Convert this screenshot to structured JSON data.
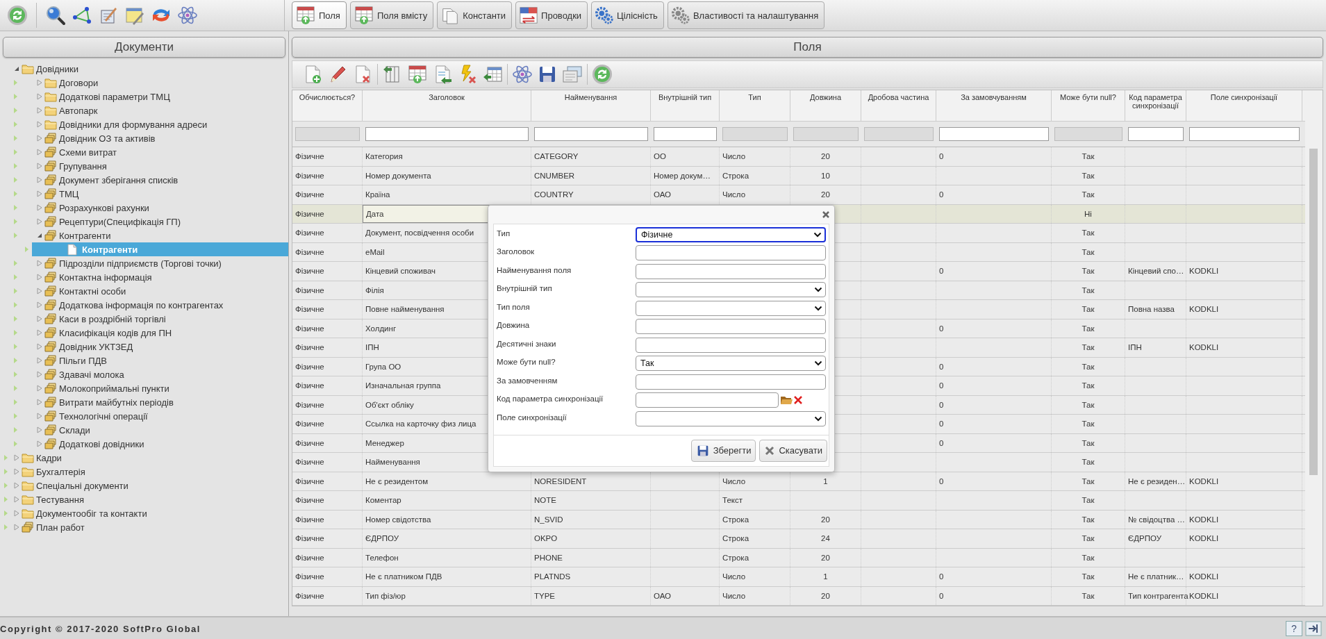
{
  "tabs": [
    {
      "label": "Поля",
      "selected": true
    },
    {
      "label": "Поля вмісту",
      "selected": false
    },
    {
      "label": "Константи",
      "selected": false
    },
    {
      "label": "Проводки",
      "selected": false
    },
    {
      "label": "Цілісність",
      "selected": false
    },
    {
      "label": "Властивості та налаштування",
      "selected": false
    }
  ],
  "sidebar": {
    "title": "Документи",
    "tree": [
      {
        "label": "Довідники",
        "kind": "folder",
        "expanded": true,
        "selected": false,
        "children": [
          {
            "label": "Договори",
            "kind": "folder",
            "expanded": false,
            "selected": false
          },
          {
            "label": "Додаткові параметри ТМЦ",
            "kind": "folder",
            "expanded": false,
            "selected": false
          },
          {
            "label": "Автопарк",
            "kind": "folder",
            "expanded": false,
            "selected": false
          },
          {
            "label": "Довідники для формування адреси",
            "kind": "folder",
            "expanded": false,
            "selected": false
          },
          {
            "label": "Довідник ОЗ та активів",
            "kind": "stack",
            "expanded": false,
            "selected": false
          },
          {
            "label": "Схеми витрат",
            "kind": "stack",
            "expanded": false,
            "selected": false
          },
          {
            "label": "Групування",
            "kind": "stack",
            "expanded": false,
            "selected": false
          },
          {
            "label": "Документ зберігання списків",
            "kind": "stack",
            "expanded": false,
            "selected": false
          },
          {
            "label": "ТМЦ",
            "kind": "stack",
            "expanded": false,
            "selected": false
          },
          {
            "label": "Розрахункові рахунки",
            "kind": "stack",
            "expanded": false,
            "selected": false
          },
          {
            "label": "Рецептури(Специфікація ГП)",
            "kind": "stack",
            "expanded": false,
            "selected": false
          },
          {
            "label": "Контрагенти",
            "kind": "stack",
            "expanded": true,
            "selected": false,
            "children": [
              {
                "label": "Контрагенти",
                "kind": "document",
                "selected": true
              }
            ]
          },
          {
            "label": "Підрозділи підприємств (Торгові точки)",
            "kind": "stack",
            "expanded": false,
            "selected": false
          },
          {
            "label": "Контактна інформація",
            "kind": "stack",
            "expanded": false,
            "selected": false
          },
          {
            "label": "Контактні особи",
            "kind": "stack",
            "expanded": false,
            "selected": false
          },
          {
            "label": "Додаткова інформація по контрагентах",
            "kind": "stack",
            "expanded": false,
            "selected": false
          },
          {
            "label": "Каси в роздрібній торгівлі",
            "kind": "stack",
            "expanded": false,
            "selected": false
          },
          {
            "label": "Класифікація кодів для ПН",
            "kind": "stack",
            "expanded": false,
            "selected": false
          },
          {
            "label": "Довідник УКТЗЕД",
            "kind": "stack",
            "expanded": false,
            "selected": false
          },
          {
            "label": "Пільги ПДВ",
            "kind": "stack",
            "expanded": false,
            "selected": false
          },
          {
            "label": "Здавачі молока",
            "kind": "stack",
            "expanded": false,
            "selected": false
          },
          {
            "label": "Молокоприймальні пункти",
            "kind": "stack",
            "expanded": false,
            "selected": false
          },
          {
            "label": "Витрати майбутніх періодів",
            "kind": "stack",
            "expanded": false,
            "selected": false
          },
          {
            "label": "Технологічні операції",
            "kind": "stack",
            "expanded": false,
            "selected": false
          },
          {
            "label": "Склади",
            "kind": "stack",
            "expanded": false,
            "selected": false
          },
          {
            "label": "Додаткові довідники",
            "kind": "stack",
            "expanded": false,
            "selected": false
          }
        ]
      },
      {
        "label": "Кадри",
        "kind": "folder",
        "expanded": false,
        "selected": false
      },
      {
        "label": "Бухгалтерія",
        "kind": "folder",
        "expanded": false,
        "selected": false
      },
      {
        "label": "Спеціальні документи",
        "kind": "folder",
        "expanded": false,
        "selected": false
      },
      {
        "label": "Тестування",
        "kind": "folder",
        "expanded": false,
        "selected": false
      },
      {
        "label": "Документообіг та контакти",
        "kind": "folder",
        "expanded": false,
        "selected": false
      },
      {
        "label": "План работ",
        "kind": "stack",
        "expanded": false,
        "selected": false
      }
    ]
  },
  "panel": {
    "title": "Поля"
  },
  "table": {
    "columns": [
      {
        "label": "Обчислюється?",
        "filter_disabled": true
      },
      {
        "label": "Заголовок",
        "filter_disabled": false
      },
      {
        "label": "Найменування",
        "filter_disabled": false
      },
      {
        "label": "Внутрішній тип",
        "filter_disabled": false
      },
      {
        "label": "Тип",
        "filter_disabled": true
      },
      {
        "label": "Довжина",
        "filter_disabled": true
      },
      {
        "label": "Дробова частина",
        "filter_disabled": true
      },
      {
        "label": "За замовчуванням",
        "filter_disabled": false
      },
      {
        "label": "Може бути null?",
        "filter_disabled": true
      },
      {
        "label": "Код параметра синхронізації",
        "filter_disabled": false
      },
      {
        "label": "Поле синхронізації",
        "filter_disabled": false
      }
    ],
    "rows": [
      {
        "selected": false,
        "cells": [
          "Фізичне",
          "Категория",
          "CATEGORY",
          "ОО",
          "Число",
          "20",
          null,
          "0",
          "Так",
          null,
          null
        ]
      },
      {
        "selected": false,
        "cells": [
          "Фізичне",
          "Номер документа",
          "CNUMBER",
          "Номер докум…",
          "Строка",
          "10",
          null,
          null,
          "Так",
          null,
          null
        ]
      },
      {
        "selected": false,
        "cells": [
          "Фізичне",
          "Країна",
          "COUNTRY",
          "ОАО",
          "Число",
          "20",
          null,
          "0",
          "Так",
          null,
          null
        ]
      },
      {
        "selected": true,
        "cells": [
          "Фізичне",
          "Дата",
          null,
          null,
          null,
          null,
          null,
          null,
          "Ні",
          null,
          null
        ]
      },
      {
        "selected": false,
        "cells": [
          "Фізичне",
          "Документ, посвідчення особи",
          null,
          null,
          null,
          null,
          null,
          null,
          "Так",
          null,
          null
        ]
      },
      {
        "selected": false,
        "cells": [
          "Фізичне",
          "eMail",
          null,
          null,
          null,
          null,
          null,
          null,
          "Так",
          null,
          null
        ]
      },
      {
        "selected": false,
        "cells": [
          "Фізичне",
          "Кінцевий споживач",
          null,
          null,
          null,
          null,
          null,
          "0",
          "Так",
          "Кінцевий спо…",
          "KODKLI"
        ]
      },
      {
        "selected": false,
        "cells": [
          "Фізичне",
          "Філія",
          null,
          null,
          null,
          null,
          null,
          null,
          "Так",
          null,
          null
        ]
      },
      {
        "selected": false,
        "cells": [
          "Фізичне",
          "Повне найменування",
          null,
          null,
          null,
          null,
          null,
          null,
          "Так",
          "Повна назва",
          "KODKLI"
        ]
      },
      {
        "selected": false,
        "cells": [
          "Фізичне",
          "Холдинг",
          null,
          null,
          null,
          null,
          null,
          "0",
          "Так",
          null,
          null
        ]
      },
      {
        "selected": false,
        "cells": [
          "Фізичне",
          "ІПН",
          null,
          null,
          null,
          null,
          null,
          null,
          "Так",
          "ІПН",
          "KODKLI"
        ]
      },
      {
        "selected": false,
        "cells": [
          "Фізичне",
          "Група ОО",
          null,
          null,
          null,
          null,
          null,
          "0",
          "Так",
          null,
          null
        ]
      },
      {
        "selected": false,
        "cells": [
          "Фізичне",
          "Изначальная группа",
          null,
          null,
          null,
          null,
          null,
          "0",
          "Так",
          null,
          null
        ]
      },
      {
        "selected": false,
        "cells": [
          "Фізичне",
          "Об'єкт обліку",
          null,
          null,
          null,
          null,
          null,
          "0",
          "Так",
          null,
          null
        ]
      },
      {
        "selected": false,
        "cells": [
          "Фізичне",
          "Ссылка на карточку физ лица",
          null,
          null,
          null,
          null,
          null,
          "0",
          "Так",
          null,
          null
        ]
      },
      {
        "selected": false,
        "cells": [
          "Фізичне",
          "Менеджер",
          null,
          null,
          null,
          null,
          null,
          "0",
          "Так",
          null,
          null
        ]
      },
      {
        "selected": false,
        "cells": [
          "Фізичне",
          "Найменування",
          null,
          null,
          null,
          null,
          null,
          null,
          "Так",
          null,
          null
        ]
      },
      {
        "selected": false,
        "cells": [
          "Фізичне",
          "Не є резидентом",
          "NORESIDENT",
          null,
          "Число",
          "1",
          null,
          "0",
          "Так",
          "Не є резиден…",
          "KODKLI"
        ]
      },
      {
        "selected": false,
        "cells": [
          "Фізичне",
          "Коментар",
          "NOTE",
          null,
          "Текст",
          null,
          null,
          null,
          "Так",
          null,
          null
        ]
      },
      {
        "selected": false,
        "cells": [
          "Фізичне",
          "Номер свідотства",
          "N_SVID",
          null,
          "Строка",
          "20",
          null,
          null,
          "Так",
          "№ свідоцтва …",
          "KODKLI"
        ]
      },
      {
        "selected": false,
        "cells": [
          "Фізичне",
          "ЄДРПОУ",
          "OKPO",
          null,
          "Строка",
          "24",
          null,
          null,
          "Так",
          "ЄДРПОУ",
          "KODKLI"
        ]
      },
      {
        "selected": false,
        "cells": [
          "Фізичне",
          "Телефон",
          "PHONE",
          null,
          "Строка",
          "20",
          null,
          null,
          "Так",
          null,
          null
        ]
      },
      {
        "selected": false,
        "cells": [
          "Фізичне",
          "Не є платником ПДВ",
          "PLATNDS",
          null,
          "Число",
          "1",
          null,
          "0",
          "Так",
          "Не є платник…",
          "KODKLI"
        ]
      },
      {
        "selected": false,
        "cells": [
          "Фізичне",
          "Тип фіз/юр",
          "TYPE",
          "ОАО",
          "Число",
          "20",
          null,
          "0",
          "Так",
          "Тип контрагента",
          "KODKLI"
        ]
      }
    ]
  },
  "dialog": {
    "fields": [
      {
        "label": "Тип",
        "kind": "select",
        "value": "Фізичне",
        "focused": true
      },
      {
        "label": "Заголовок",
        "kind": "input",
        "focused": false
      },
      {
        "label": "Найменування поля",
        "kind": "input",
        "focused": false
      },
      {
        "label": "Внутрішній тип",
        "kind": "select",
        "focused": false
      },
      {
        "label": "Тип поля",
        "kind": "select",
        "focused": false
      },
      {
        "label": "Довжина",
        "kind": "input",
        "focused": false
      },
      {
        "label": "Десятичні знаки",
        "kind": "input",
        "focused": false
      },
      {
        "label": "Може бути null?",
        "kind": "select",
        "value": "Так",
        "focused": false
      },
      {
        "label": "За замовченням",
        "kind": "input",
        "focused": false
      },
      {
        "label": "Код параметра синхронізації",
        "kind": "lookup",
        "focused": false
      },
      {
        "label": "Поле синхронізації",
        "kind": "select",
        "focused": false
      }
    ],
    "buttons": [
      "Зберегти",
      "Скасувати"
    ]
  },
  "status_bar": {
    "copyright": "Copyright © 2017-2020 SoftPro Global",
    "help": "?"
  }
}
